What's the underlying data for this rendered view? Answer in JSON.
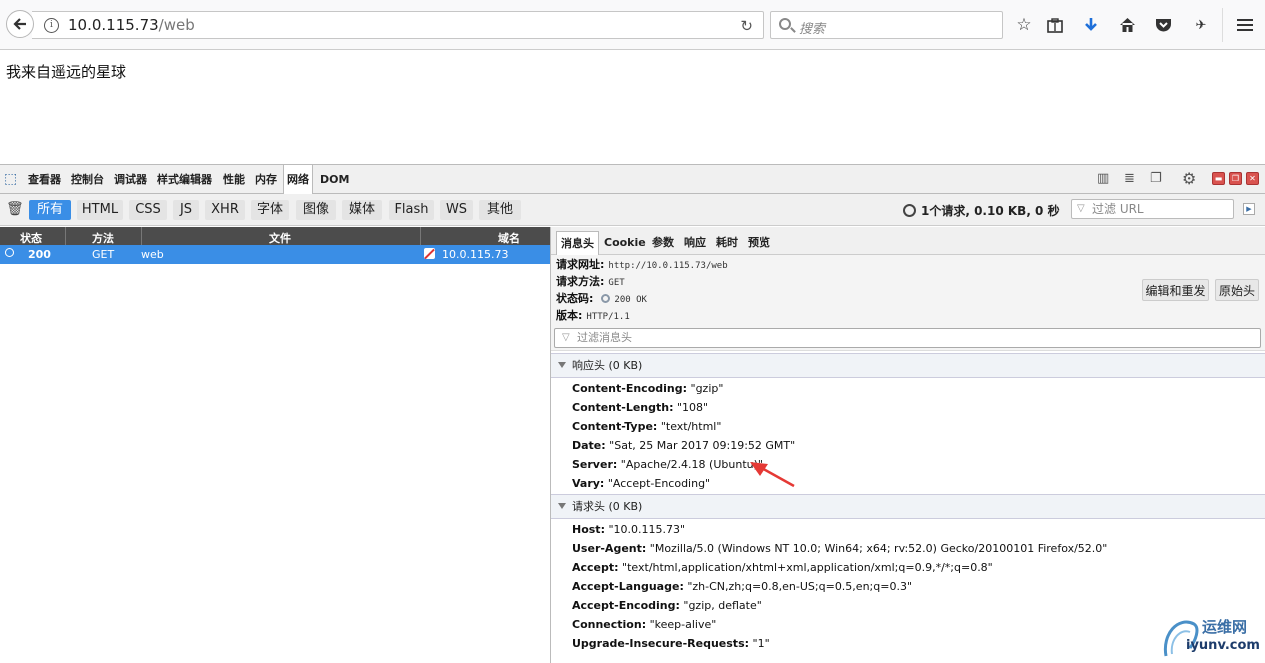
{
  "browser": {
    "url_host": "10.0.115.73",
    "url_path": "/web",
    "search_placeholder": "搜索"
  },
  "page": {
    "text": "我来自遥远的星球"
  },
  "devtools": {
    "tabs": [
      "查看器",
      "控制台",
      "调试器",
      "样式编辑器",
      "性能",
      "内存",
      "网络",
      "DOM"
    ],
    "active_tab": "网络",
    "filters": [
      "所有",
      "HTML",
      "CSS",
      "JS",
      "XHR",
      "字体",
      "图像",
      "媒体",
      "Flash",
      "WS",
      "其他"
    ],
    "active_filter": "所有",
    "summary": "1个请求, 0.10 KB, 0 秒",
    "url_filter_placeholder": "过滤 URL"
  },
  "request_table": {
    "columns": [
      "状态",
      "方法",
      "文件",
      "域名"
    ],
    "rows": [
      {
        "status": "200",
        "method": "GET",
        "file": "web",
        "domain": "10.0.115.73"
      }
    ]
  },
  "details": {
    "tabs": [
      "消息头",
      "Cookie",
      "参数",
      "响应",
      "耗时",
      "预览"
    ],
    "active_tab": "消息头",
    "request_url_label": "请求网址:",
    "request_url": "http://10.0.115.73/web",
    "method_label": "请求方法:",
    "method": "GET",
    "status_label": "状态码:",
    "status": "200 OK",
    "version_label": "版本:",
    "version": "HTTP/1.1",
    "edit_resend_label": "编辑和重发",
    "raw_headers_label": "原始头",
    "header_filter_placeholder": "过滤消息头",
    "response_section": "响应头 (0 KB)",
    "response_headers": [
      {
        "name": "Content-Encoding:",
        "value": "\"gzip\""
      },
      {
        "name": "Content-Length:",
        "value": "\"108\""
      },
      {
        "name": "Content-Type:",
        "value": "\"text/html\""
      },
      {
        "name": "Date:",
        "value": "\"Sat, 25 Mar 2017 09:19:52 GMT\""
      },
      {
        "name": "Server:",
        "value": "\"Apache/2.4.18 (Ubuntu)\""
      },
      {
        "name": "Vary:",
        "value": "\"Accept-Encoding\""
      }
    ],
    "request_section": "请求头 (0 KB)",
    "request_headers": [
      {
        "name": "Host:",
        "value": "\"10.0.115.73\""
      },
      {
        "name": "User-Agent:",
        "value": "\"Mozilla/5.0 (Windows NT 10.0; Win64; x64; rv:52.0) Gecko/20100101 Firefox/52.0\""
      },
      {
        "name": "Accept:",
        "value": "\"text/html,application/xhtml+xml,application/xml;q=0.9,*/*;q=0.8\""
      },
      {
        "name": "Accept-Language:",
        "value": "\"zh-CN,zh;q=0.8,en-US;q=0.5,en;q=0.3\""
      },
      {
        "name": "Accept-Encoding:",
        "value": "\"gzip, deflate\""
      },
      {
        "name": "Connection:",
        "value": "\"keep-alive\""
      },
      {
        "name": "Upgrade-Insecure-Requests:",
        "value": "\"1\""
      }
    ]
  },
  "watermark": {
    "line1": "运维网",
    "line2": "iyunv.com"
  },
  "colors": {
    "accent": "#3a8ee6",
    "arrow": "#e53935"
  }
}
